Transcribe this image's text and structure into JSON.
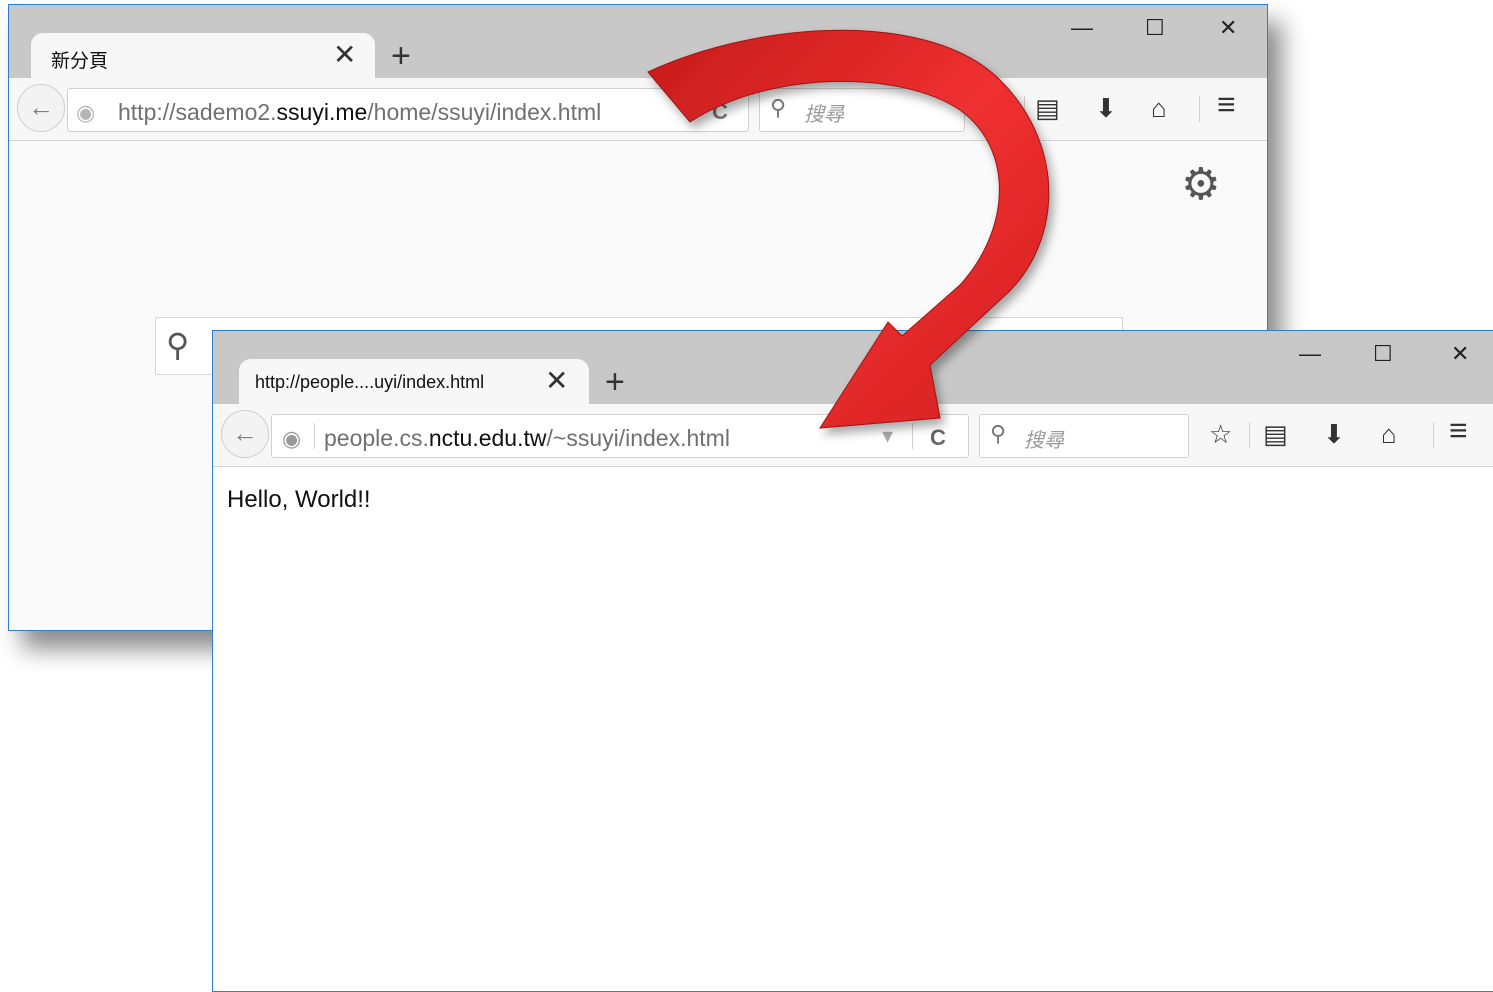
{
  "window_back": {
    "tab_title": "新分頁",
    "tab_close": "✕",
    "new_tab": "+",
    "controls": {
      "minimize": "—",
      "maximize": "☐",
      "close": "✕"
    },
    "back": "←",
    "url_prefix": "http://sademo2.",
    "url_domain": "ssuyi.me",
    "url_suffix": "/home/ssuyi/index.html",
    "reload": "C",
    "search_placeholder": "搜尋",
    "icons": {
      "bookmarks": "☆",
      "library": "▤",
      "downloads": "⬇",
      "home": "⌂",
      "menu": "≡",
      "settings": "⚙",
      "search": "⚲"
    }
  },
  "window_front": {
    "tab_title": "http://people....uyi/index.html",
    "tab_close": "✕",
    "new_tab": "+",
    "controls": {
      "minimize": "—",
      "maximize": "☐",
      "close": "✕"
    },
    "back": "←",
    "url_prefix": "people.cs.",
    "url_domain": "nctu.edu.tw",
    "url_suffix": "/~ssuyi/index.html",
    "dropdown": "▾",
    "reload": "C",
    "search_placeholder": "搜尋",
    "page_text": "Hello, World!!",
    "icons": {
      "bookmarks": "☆",
      "library": "▤",
      "downloads": "⬇",
      "home": "⌂",
      "menu": "≡",
      "search": "⚲"
    }
  },
  "colors": {
    "arrow": "#e02222",
    "window_border": "#2b7fd6",
    "titlebar": "#c8c8c8"
  }
}
